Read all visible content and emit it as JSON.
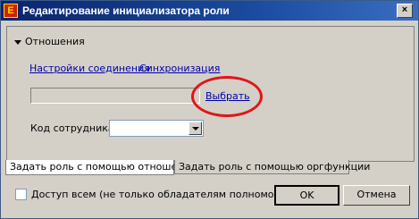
{
  "window": {
    "title": "Редактирование инициализатора роли",
    "close_label": "×"
  },
  "section": {
    "label": "Отношения"
  },
  "links": {
    "connection_settings": "Настройки соединения",
    "sync": "Синхронизация"
  },
  "role_field": {
    "value": ""
  },
  "select_link": "Выбрать",
  "employee_code": {
    "label": "Код сотрудника",
    "value": ""
  },
  "tabs": [
    {
      "label": "Задать роль с помощью отношения",
      "active": true
    },
    {
      "label": "Задать роль с помощью оргфункции",
      "active": false
    }
  ],
  "footer": {
    "checkbox_label": "Доступ всем (не только обладателям полномочий)",
    "checked": false,
    "ok_label": "OK",
    "cancel_label": "Отмена"
  },
  "app_icon_letter": "E"
}
